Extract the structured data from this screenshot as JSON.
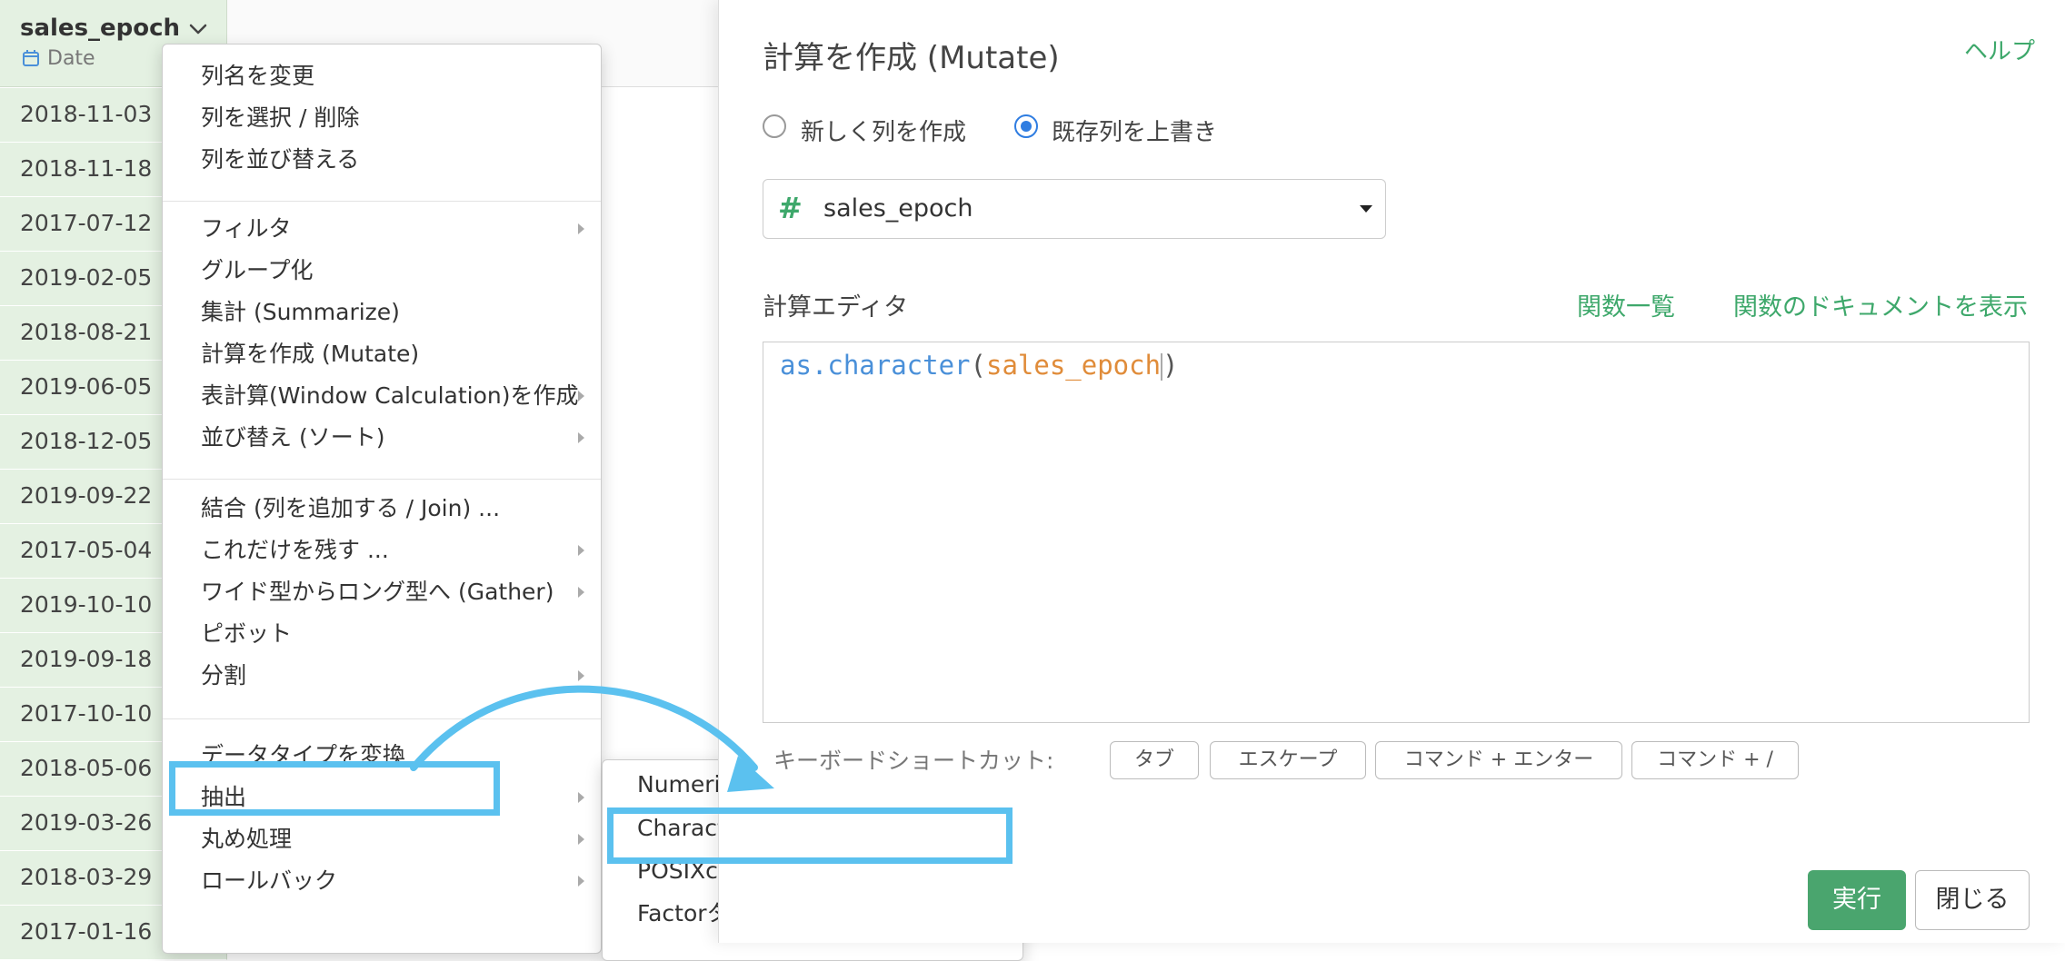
{
  "column": {
    "name": "sales_epoch",
    "type": "Date"
  },
  "rows": [
    "2018-11-03",
    "2018-11-18",
    "2017-07-12",
    "2019-02-05",
    "2018-08-21",
    "2019-06-05",
    "2018-12-05",
    "2019-09-22",
    "2017-05-04",
    "2019-10-10",
    "2019-09-18",
    "2017-10-10",
    "2018-05-06",
    "2019-03-26",
    "2018-03-29",
    "2017-01-16"
  ],
  "context_menu": {
    "items": [
      {
        "label": "列名を変更",
        "arrow": false
      },
      {
        "label": "列を選択 / 削除",
        "arrow": false
      },
      {
        "label": "列を並び替える",
        "arrow": false
      },
      {
        "label": "フィルタ",
        "arrow": true
      },
      {
        "label": "グループ化",
        "arrow": false
      },
      {
        "label": "集計 (Summarize)",
        "arrow": false
      },
      {
        "label": "計算を作成 (Mutate)",
        "arrow": false
      },
      {
        "label": "表計算(Window Calculation)を作成",
        "arrow": true
      },
      {
        "label": "並び替え (ソート)",
        "arrow": true
      },
      {
        "label": "結合 (列を追加する / Join) ...",
        "arrow": false
      },
      {
        "label": "これだけを残す ...",
        "arrow": true
      },
      {
        "label": "ワイド型からロング型へ (Gather)",
        "arrow": true
      },
      {
        "label": "ピボット",
        "arrow": false
      },
      {
        "label": "分割",
        "arrow": true
      },
      {
        "label": "データタイプを変換",
        "arrow": false
      },
      {
        "label": "抽出",
        "arrow": true
      },
      {
        "label": "丸め処理",
        "arrow": true
      },
      {
        "label": "ロールバック",
        "arrow": true
      }
    ]
  },
  "submenu": {
    "items": [
      {
        "label": "Numeric (数値) タイプに変換",
        "arrow": true
      },
      {
        "label": "Character (文字) タイプに変換",
        "arrow": false
      },
      {
        "label": "POSIXctタイプに変換",
        "arrow": false
      },
      {
        "label": "Factorタイプに変換",
        "arrow": false
      }
    ]
  },
  "modal": {
    "title": "計算を作成 (Mutate)",
    "help": "ヘルプ",
    "radio_new": "新しく列を作成",
    "radio_overwrite": "既存列を上書き",
    "selected_option": "overwrite",
    "column_select": {
      "icon": "#",
      "value": "sales_epoch"
    },
    "editor_label": "計算エディタ",
    "fn_list": "関数一覧",
    "fn_doc": "関数のドキュメントを表示",
    "code": {
      "fn": "as.character",
      "open": "(",
      "arg": "sales_epoch",
      "close": ")"
    },
    "shortcut_label": "キーボードショートカット:",
    "shortcuts": [
      "タブ",
      "エスケープ",
      "コマンド + エンター",
      "コマンド + /"
    ],
    "run": "実行",
    "close": "閉じる"
  },
  "colors": {
    "accent_green": "#3ea86b",
    "highlight_blue": "#5bc1ef",
    "row_green": "#e4f1e2",
    "run_button": "#4aa56e"
  }
}
